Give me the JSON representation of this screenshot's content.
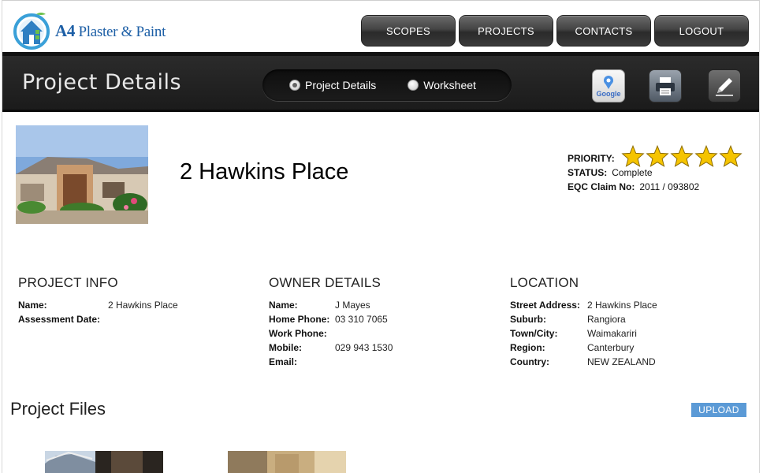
{
  "header": {
    "logo_text_a": "A4",
    "logo_text_b": "Plaster & Paint",
    "nav": [
      "SCOPES",
      "PROJECTS",
      "CONTACTS",
      "LOGOUT"
    ]
  },
  "titlebar": {
    "title": "Project Details",
    "toggle_options": [
      {
        "label": "Project Details",
        "selected": true
      },
      {
        "label": "Worksheet",
        "selected": false
      }
    ],
    "tools": [
      {
        "icon": "google-maps-icon",
        "label": "Google"
      },
      {
        "icon": "printer-icon"
      },
      {
        "icon": "pencil-edit-icon"
      }
    ]
  },
  "project": {
    "address": "2 Hawkins Place",
    "priority_label": "PRIORITY:",
    "priority_stars": 5,
    "status_label": "STATUS:",
    "status": "Complete",
    "eqc_label": "EQC Claim No:",
    "eqc": "2011 / 093802"
  },
  "project_info": {
    "heading": "PROJECT INFO",
    "rows": [
      {
        "k": "Name:",
        "v": "2 Hawkins Place"
      },
      {
        "k": "Assessment Date:",
        "v": ""
      }
    ]
  },
  "owner_details": {
    "heading": "OWNER DETAILS",
    "rows": [
      {
        "k": "Name:",
        "v": "J Mayes"
      },
      {
        "k": "Home Phone:",
        "v": "03 310 7065"
      },
      {
        "k": "Work Phone:",
        "v": ""
      },
      {
        "k": "Mobile:",
        "v": "029 943 1530"
      },
      {
        "k": "Email:",
        "v": ""
      }
    ]
  },
  "location": {
    "heading": "LOCATION",
    "rows": [
      {
        "k": "Street Address:",
        "v": "2 Hawkins Place"
      },
      {
        "k": "Suburb:",
        "v": "Rangiora"
      },
      {
        "k": "Town/City:",
        "v": "Waimakariri"
      },
      {
        "k": "Region:",
        "v": "Canterbury"
      },
      {
        "k": "Country:",
        "v": "NEW ZEALAND"
      }
    ]
  },
  "files": {
    "heading": "Project Files",
    "upload_label": "UPLOAD"
  },
  "colors": {
    "logo_blue": "#1d5fa6",
    "upload_blue": "#5b9ad6",
    "star_gold": "#f5c400"
  }
}
